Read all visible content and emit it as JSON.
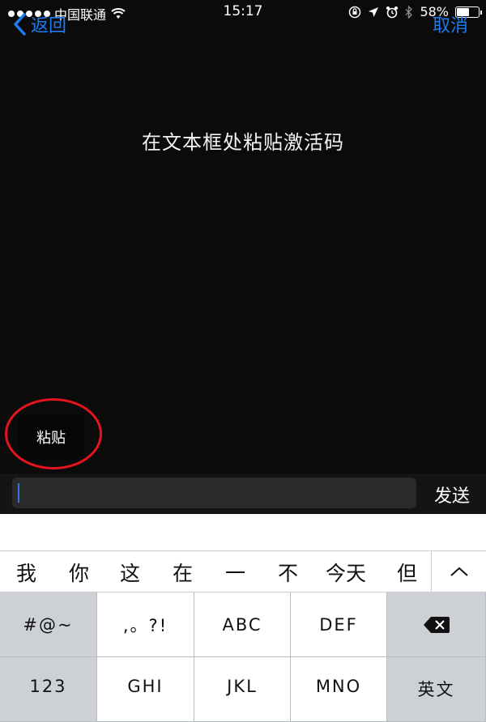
{
  "status_bar": {
    "carrier": "中国联通",
    "time": "15:17",
    "battery_percent": "58%",
    "battery_level": 0.58
  },
  "nav": {
    "back_label": "返回",
    "cancel_label": "取消"
  },
  "instruction": "在文本框处粘贴激活码",
  "paste_menu": {
    "label": "粘贴"
  },
  "input_bar": {
    "value": "",
    "send_label": "发送"
  },
  "candidates": [
    "我",
    "你",
    "这",
    "在",
    "一",
    "不",
    "今天",
    "但"
  ],
  "keyboard": {
    "row1": [
      "#@~",
      ",。?!",
      "ABC",
      "DEF"
    ],
    "row2": [
      "123",
      "GHI",
      "JKL",
      "MNO",
      "英文"
    ]
  },
  "icons": {
    "back": "chevron-left-icon",
    "wifi": "wifi-icon",
    "lock_rotation": "rotation-lock-icon",
    "location": "location-arrow-icon",
    "alarm": "alarm-icon",
    "bluetooth": "bluetooth-icon",
    "battery": "battery-icon",
    "expand": "chevron-up-icon",
    "delete": "delete-backspace-icon"
  },
  "colors": {
    "accent": "#1d7cf2",
    "highlight_circle": "#e5141c"
  }
}
